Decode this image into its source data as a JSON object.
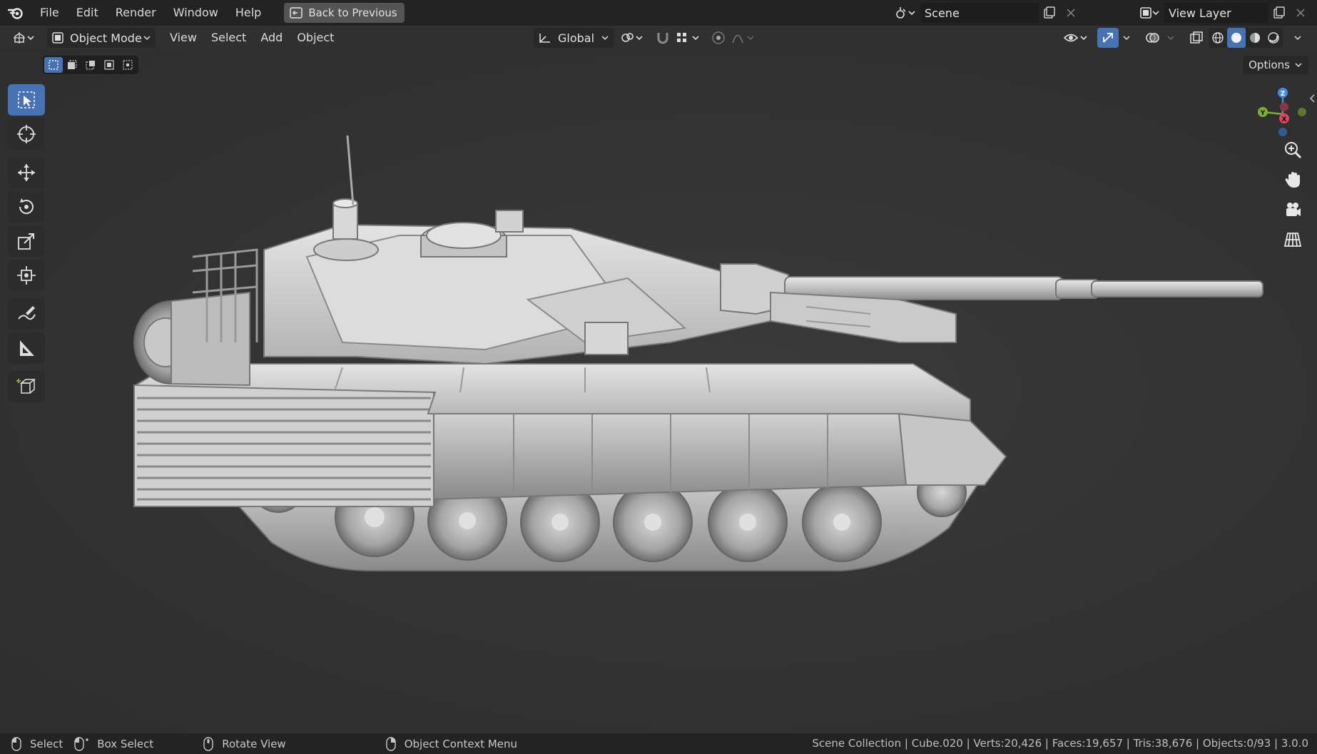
{
  "menu": {
    "items": [
      "File",
      "Edit",
      "Render",
      "Window",
      "Help"
    ],
    "back_label": "Back to Previous"
  },
  "scene": {
    "name": "Scene"
  },
  "view_layer": {
    "name": "View Layer"
  },
  "header": {
    "mode": "Object Mode",
    "menus": [
      "View",
      "Select",
      "Add",
      "Object"
    ],
    "transform_orientation": "Global",
    "options_label": "Options"
  },
  "gizmo": {
    "axes": [
      "X",
      "Y",
      "Z"
    ]
  },
  "status": {
    "select_label": "Select",
    "box_select_label": "Box Select",
    "rotate_label": "Rotate View",
    "context_label": "Object Context Menu",
    "stats": "Scene Collection | Cube.020 | Verts:20,426 | Faces:19,657 | Tris:38,676 | Objects:0/93 | 3.0.0"
  },
  "colors": {
    "accent": "#4772b3",
    "x_axis": "#e0445a",
    "y_axis": "#7bb02c",
    "z_axis": "#3f8dde"
  }
}
